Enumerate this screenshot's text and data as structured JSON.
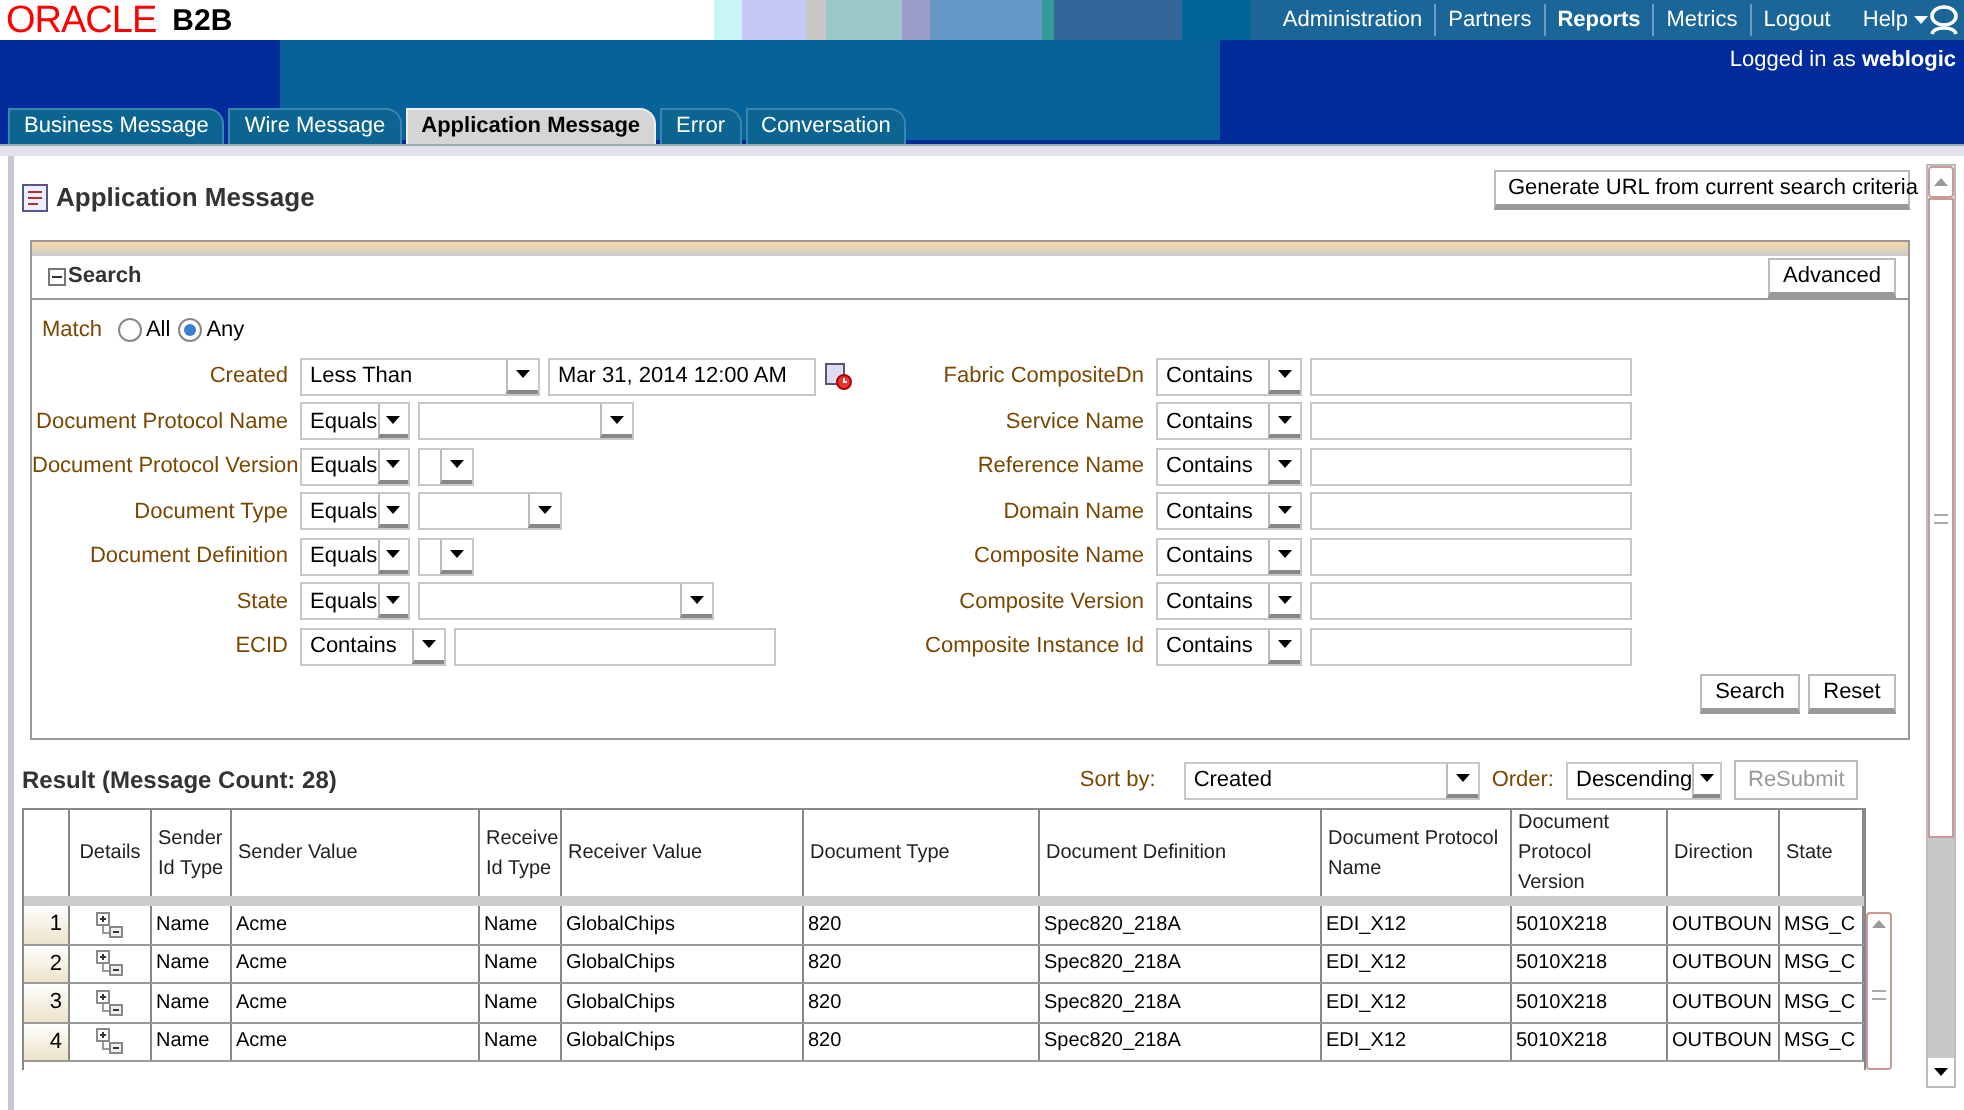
{
  "header": {
    "logo": "ORACLE",
    "product": "B2B",
    "nav": [
      {
        "label": "Administration",
        "selected": false
      },
      {
        "label": "Partners",
        "selected": false
      },
      {
        "label": "Reports",
        "selected": true
      },
      {
        "label": "Metrics",
        "selected": false
      },
      {
        "label": "Logout",
        "selected": false
      }
    ],
    "help": "Help",
    "user_prefix": "Logged in as",
    "user": "weblogic"
  },
  "tabs": [
    {
      "label": "Business Message",
      "selected": false
    },
    {
      "label": "Wire Message",
      "selected": false
    },
    {
      "label": "Application Message",
      "selected": true
    },
    {
      "label": "Error",
      "selected": false
    },
    {
      "label": "Conversation",
      "selected": false
    }
  ],
  "page": {
    "title": "Application Message",
    "generate_button": "Generate URL from current search criteria"
  },
  "search": {
    "title": "Search",
    "expanded": true,
    "advanced_button": "Advanced",
    "match_label": "Match",
    "match_options": [
      {
        "label": "All",
        "selected": false
      },
      {
        "label": "Any",
        "selected": true
      }
    ],
    "left_fields": [
      {
        "label": "Created",
        "operator": "Less Than",
        "kind": "date",
        "value": "Mar 31, 2014 12:00 AM"
      },
      {
        "label": "Document Protocol Name",
        "operator": "Equals",
        "kind": "select-medium"
      },
      {
        "label": "Document Protocol Version",
        "operator": "Equals",
        "kind": "select-short"
      },
      {
        "label": "Document Type",
        "operator": "Equals",
        "kind": "select-small"
      },
      {
        "label": "Document Definition",
        "operator": "Equals",
        "kind": "select-short"
      },
      {
        "label": "State",
        "operator": "Equals",
        "kind": "select-long"
      },
      {
        "label": "ECID",
        "operator": "Contains",
        "kind": "text"
      }
    ],
    "right_fields": [
      {
        "label": "Fabric CompositeDn",
        "operator": "Contains",
        "kind": "text"
      },
      {
        "label": "Service Name",
        "operator": "Contains",
        "kind": "text"
      },
      {
        "label": "Reference Name",
        "operator": "Contains",
        "kind": "text"
      },
      {
        "label": "Domain Name",
        "operator": "Contains",
        "kind": "text"
      },
      {
        "label": "Composite Name",
        "operator": "Contains",
        "kind": "text"
      },
      {
        "label": "Composite Version",
        "operator": "Contains",
        "kind": "text"
      },
      {
        "label": "Composite Instance Id",
        "operator": "Contains",
        "kind": "text"
      }
    ],
    "buttons": [
      "Search",
      "Reset"
    ]
  },
  "result": {
    "title": "Result (Message Count: 28)",
    "sort_label": "Sort by:",
    "sort_value": "Created",
    "order_label": "Order:",
    "order_value": "Descending",
    "resubmit": {
      "label": "ReSubmit",
      "disabled": true
    },
    "columns": [
      "",
      "Details",
      "Sender Id Type",
      "Sender Value",
      "Receive Id Type",
      "Receiver Value",
      "Document Type",
      "Document Definition",
      "Document Protocol Name",
      "Document Protocol Version",
      "Direction",
      "State"
    ],
    "rows": [
      {
        "cells": [
          "1",
          "",
          "Name",
          "Acme",
          "Name",
          "GlobalChips",
          "820",
          "Spec820_218A",
          "EDI_X12",
          "5010X218",
          "OUTBOUN",
          "MSG_C"
        ]
      },
      {
        "cells": [
          "2",
          "",
          "Name",
          "Acme",
          "Name",
          "GlobalChips",
          "820",
          "Spec820_218A",
          "EDI_X12",
          "5010X218",
          "OUTBOUN",
          "MSG_C"
        ]
      },
      {
        "cells": [
          "3",
          "",
          "Name",
          "Acme",
          "Name",
          "GlobalChips",
          "820",
          "Spec820_218A",
          "EDI_X12",
          "5010X218",
          "OUTBOUN",
          "MSG_C"
        ]
      },
      {
        "cells": [
          "4",
          "",
          "Name",
          "Acme",
          "Name",
          "GlobalChips",
          "820",
          "Spec820_218A",
          "EDI_X12",
          "5010X218",
          "OUTBOUN",
          "MSG_C"
        ]
      }
    ]
  }
}
